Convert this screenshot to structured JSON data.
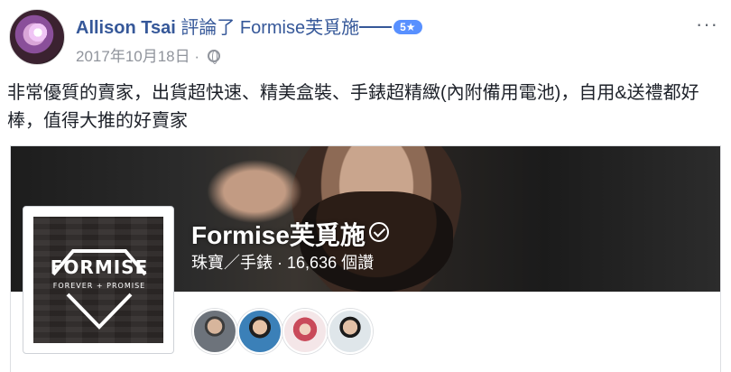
{
  "post": {
    "author": "Allison Tsai",
    "action": "評論了",
    "target": "Formise芙覓施",
    "rating": "5★",
    "date": "2017年10月18日",
    "separator": "·",
    "body": "非常優質的賣家，出貨超快速、精美盒裝、手錶超精緻(內附備用電池)，自用&送禮都好棒，值得大推的好賣家",
    "more_label": "···",
    "icons": {
      "privacy": "globe-icon",
      "more": "more-horizontal-icon"
    }
  },
  "page_card": {
    "name": "Formise芙覓施",
    "category": "珠寶／手錶",
    "likes_separator": "·",
    "likes": "16,636 個讚",
    "logo": {
      "word": "FORMISE",
      "tagline": "FOREVER + PROMISE"
    },
    "friends": [
      {
        "label": "friend-avatar-1"
      },
      {
        "label": "friend-avatar-2"
      },
      {
        "label": "friend-avatar-3"
      },
      {
        "label": "friend-avatar-4"
      }
    ],
    "icons": {
      "verified": "verified-check-icon"
    }
  },
  "colors": {
    "link": "#365899",
    "meta": "#90949c",
    "badge": "#5890ff",
    "text": "#1d2129"
  }
}
